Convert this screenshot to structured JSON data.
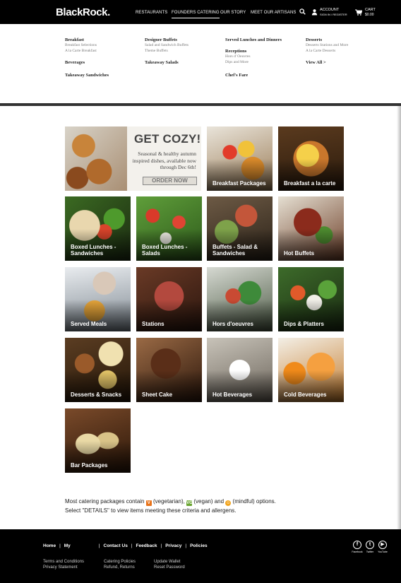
{
  "header": {
    "logo": "BlackRock.",
    "nav": [
      {
        "label": "RESTAURANTS",
        "active": false
      },
      {
        "label": "FOUNDERS CATERING",
        "active": true
      },
      {
        "label": "OUR STORY",
        "active": false
      },
      {
        "label": "MEET OUR ARTISANS",
        "active": false
      }
    ],
    "account_label": "ACCOUNT",
    "account_sub": "SIGN IN / REGISTER",
    "cart_label": "CART",
    "cart_total": "$0.00"
  },
  "menu": {
    "col1": {
      "breakfast": "Breakfast",
      "breakfast_items": [
        "Breakfast Selections",
        "A la Carte Breakfast"
      ],
      "beverages": "Beverages",
      "takeaway_sandwiches": "Takeaway Sandwiches"
    },
    "col2": {
      "designer_buffets": "Designer Buffets",
      "designer_items": [
        "Salad and Sandwich Buffets",
        "Theme Buffets"
      ],
      "takeaway_salads": "Takeaway Salads"
    },
    "col3": {
      "served": "Served Lunches and Dinners",
      "receptions": "Receptions",
      "reception_items": [
        "Hors d' Oeuvres",
        "Dips and More"
      ],
      "chefs_fare": "Chef's Fare"
    },
    "col4": {
      "desserts": "Desserts",
      "dessert_items": [
        "Desserts Stations and More",
        "A la Carte Desserts"
      ],
      "view_all": "View All >"
    }
  },
  "promo": {
    "title": "GET COZY!",
    "text": "Seasonal & healthy autumn inspired dishes, available now through Dec 6th!",
    "button": "ORDER NOW"
  },
  "tiles": [
    {
      "label": "Breakfast Packages"
    },
    {
      "label": "Breakfast a la carte"
    },
    {
      "label": "Boxed Lunches - Sandwiches"
    },
    {
      "label": "Boxed Lunches - Salads"
    },
    {
      "label": "Buffets - Salad & Sandwiches"
    },
    {
      "label": "Hot Buffets"
    },
    {
      "label": "Served Meals"
    },
    {
      "label": "Stations"
    },
    {
      "label": "Hors d'oeuvres"
    },
    {
      "label": "Dips & Platters"
    },
    {
      "label": "Desserts & Snacks"
    },
    {
      "label": "Sheet Cake"
    },
    {
      "label": "Hot Beverages"
    },
    {
      "label": "Cold Beverages"
    },
    {
      "label": "Bar Packages"
    }
  ],
  "note": {
    "line1_a": "Most catering packages contain",
    "vegetarian": "(vegetarian),",
    "vegan": "(vegan) and",
    "mindful": "(mindful) options.",
    "line2": "Select \"DETAILS\" to view items meeting these criteria and allergens."
  },
  "footer": {
    "links": [
      "Home",
      "My",
      "Contact Us",
      "Feedback",
      "Privacy",
      "Policies"
    ],
    "col1": [
      "Terms and Conditions",
      "Privacy Statement"
    ],
    "col2": [
      "Catering Policies",
      "Refund, Returns"
    ],
    "col3": [
      "Update Wallet",
      "Reset Password"
    ],
    "social": [
      "Facebook",
      "Twitter",
      "YouTube"
    ]
  },
  "colors": {
    "header_bg": "#000000",
    "vegetarian": "#e8731a",
    "vegan": "#6aa531",
    "mindful": "#f2a51f"
  }
}
